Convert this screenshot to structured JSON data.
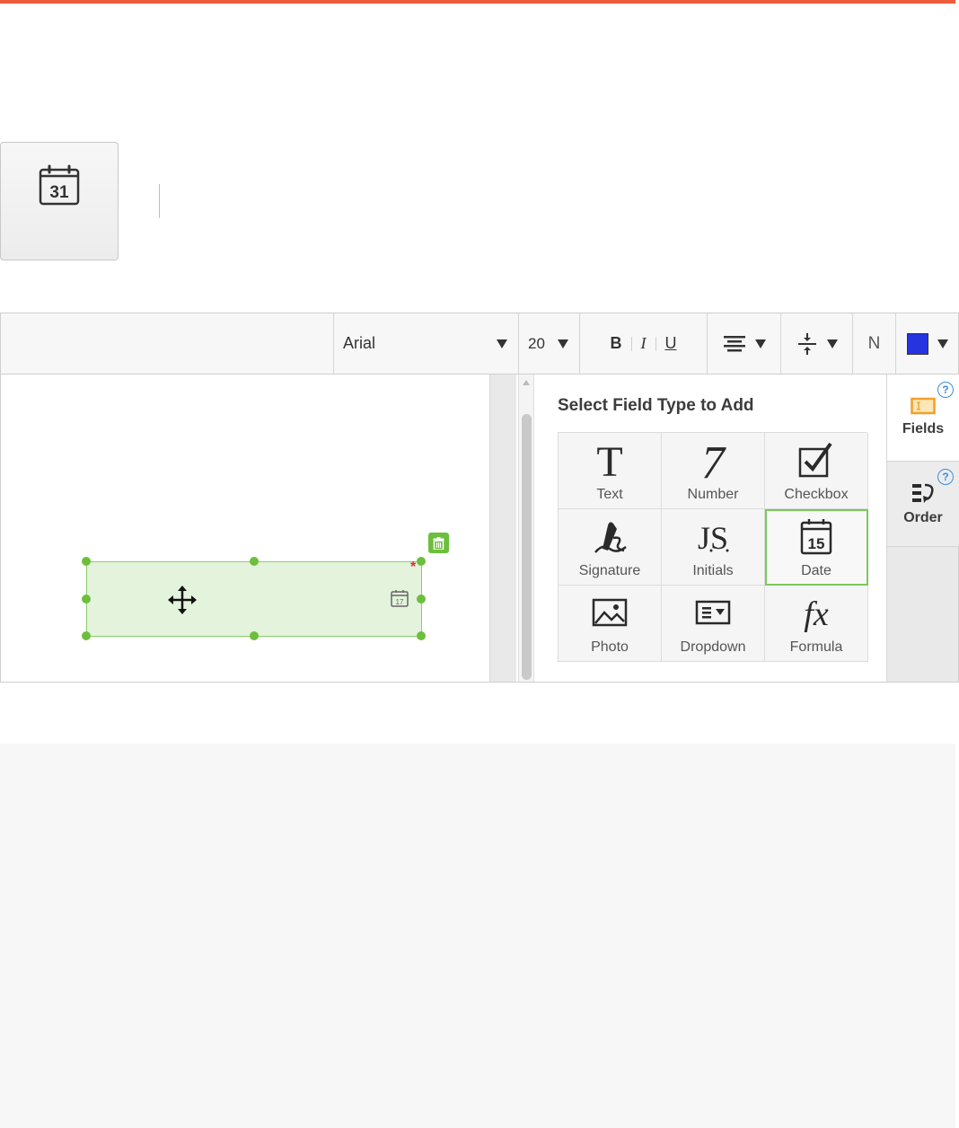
{
  "toolbar": {
    "font_family": "Arial",
    "font_size": "20",
    "bold_label": "B",
    "italic_label": "I",
    "underline_label": "U",
    "n_label": "N",
    "color_swatch": "#2533e0"
  },
  "date_button": {
    "day_number": "31"
  },
  "field_on_canvas": {
    "icon_day": "17"
  },
  "panel": {
    "title": "Select Field Type to Add",
    "field_types": [
      {
        "label": "Text",
        "icon": "text-icon"
      },
      {
        "label": "Number",
        "icon": "number-icon"
      },
      {
        "label": "Checkbox",
        "icon": "checkbox-icon"
      },
      {
        "label": "Signature",
        "icon": "signature-icon"
      },
      {
        "label": "Initials",
        "icon": "initials-icon"
      },
      {
        "label": "Date",
        "icon": "date-icon",
        "day": "15"
      },
      {
        "label": "Photo",
        "icon": "photo-icon"
      },
      {
        "label": "Dropdown",
        "icon": "dropdown-icon"
      },
      {
        "label": "Formula",
        "icon": "formula-icon"
      }
    ]
  },
  "side_tabs": {
    "fields_label": "Fields",
    "order_label": "Order",
    "help_symbol": "?"
  },
  "colors": {
    "accent_top": "#ee5a3c",
    "field_green": "#6cbf3c",
    "selected_outline": "#7cc85a",
    "help_blue": "#3b8fd8"
  }
}
